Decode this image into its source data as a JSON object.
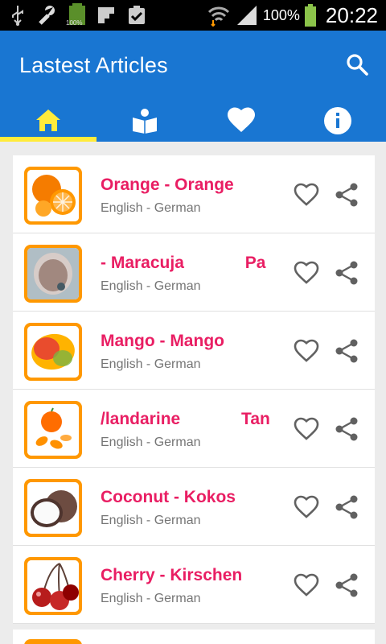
{
  "status_bar": {
    "battery_percent": "100%",
    "small_battery_label": "100%",
    "time": "20:22",
    "icons": [
      "usb-icon",
      "wrench-icon",
      "battery-small-icon",
      "flipboard-icon",
      "clipboard-check-icon",
      "wifi-icon",
      "signal-icon",
      "battery-icon"
    ]
  },
  "app_bar": {
    "title": "Lastest Articles",
    "color": "#1976d2",
    "accent": "#ffeb3b",
    "tabs": [
      {
        "icon": "home-icon",
        "selected": true
      },
      {
        "icon": "reader-icon",
        "selected": false
      },
      {
        "icon": "heart-icon",
        "selected": false
      },
      {
        "icon": "info-icon",
        "selected": false
      }
    ]
  },
  "articles": [
    {
      "title": "Orange - Orange",
      "subtitle": "English - German",
      "image": "orange-image"
    },
    {
      "title": "- Maracuja             Pa",
      "subtitle": "English - German",
      "image": "passionfruit-image"
    },
    {
      "title": "Mango - Mango",
      "subtitle": "English - German",
      "image": "mango-image"
    },
    {
      "title": "/landarine             Tan",
      "subtitle": "English - German",
      "image": "mandarin-image"
    },
    {
      "title": "Coconut - Kokos",
      "subtitle": "English - German",
      "image": "coconut-image"
    },
    {
      "title": "Cherry - Kirschen",
      "subtitle": "English - German",
      "image": "cherry-image"
    }
  ],
  "colors": {
    "title_pink": "#e91e63",
    "subtitle_gray": "#757575",
    "thumb_border": "#ff9800",
    "icon_gray": "#616161"
  }
}
